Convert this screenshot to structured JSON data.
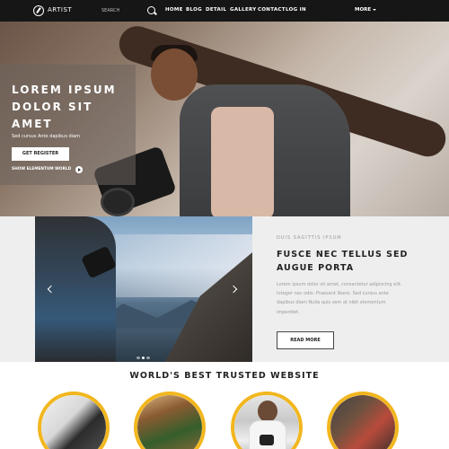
{
  "nav": {
    "brand": "ARTIST",
    "search_placeholder": "SEARCH",
    "items": [
      "HOME",
      "BLOG",
      "DETAIL",
      "GALLERY",
      "CONTACT",
      "LOG IN"
    ],
    "more": "MORE"
  },
  "hero": {
    "title": "LOREM IPSUM DOLOR SIT AMET",
    "subtitle": "Sed cursus Ante dapibus diam",
    "cta": "GET REGISTER",
    "link": "SHOW ELEMENTUM WORLD"
  },
  "feature": {
    "kicker": "DUIS SAGITTIS IPSUM",
    "title": "FUSCE NEC TELLUS SED AUGUE PORTA",
    "body": "Lorem ipsum dolor sit amet, consectetur adipiscing elit. Integer nec odio. Praesent libero. Sed cursus ante dapibus diam Nulla quis sem at nibh elementum imperdiet.",
    "button": "READ MORE"
  },
  "trusted": {
    "title": "WORLD'S BEST TRUSTED WEBSITE"
  },
  "colors": {
    "accent_yellow": "#f2b61e",
    "accent_green": "#24c26b",
    "nav_bg": "#161616"
  }
}
